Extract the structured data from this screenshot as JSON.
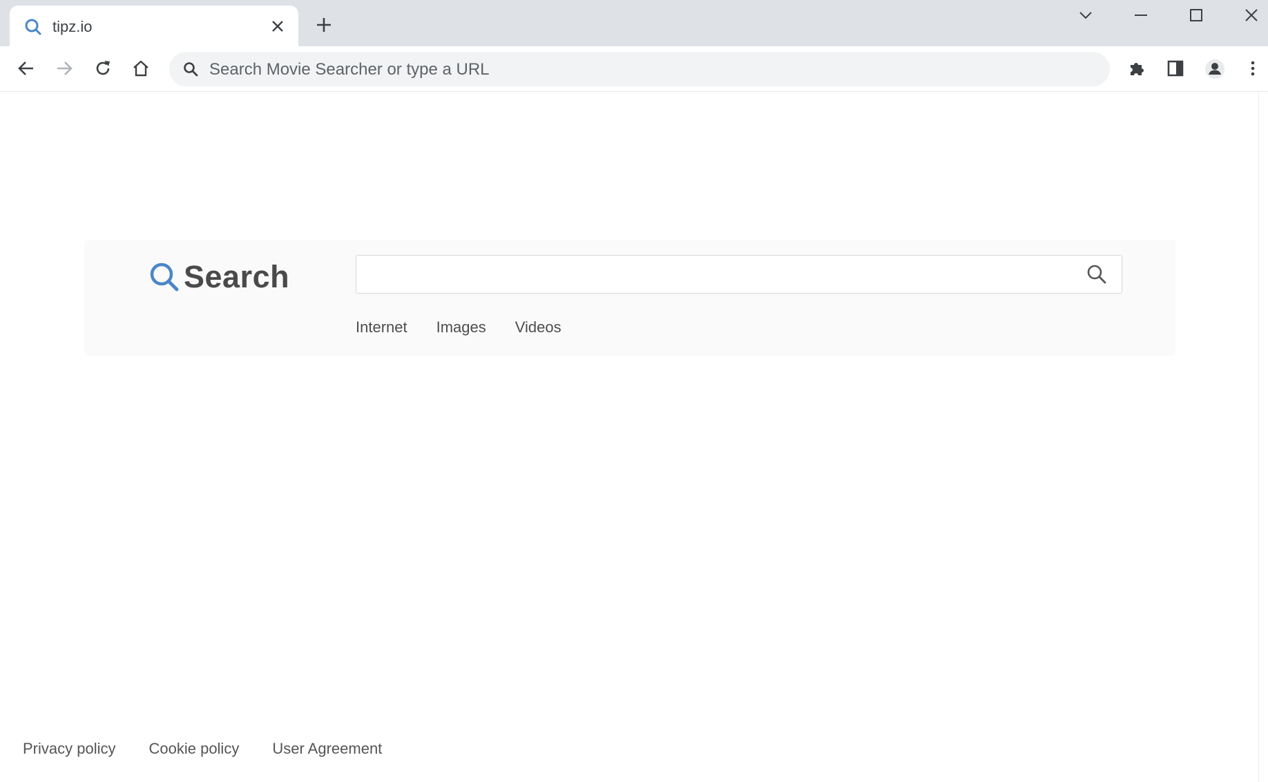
{
  "browser": {
    "tab": {
      "title": "tipz.io"
    },
    "omnibox": {
      "placeholder": "Search Movie Searcher or type a URL"
    }
  },
  "page": {
    "logo": {
      "text": "Search"
    },
    "search": {
      "value": ""
    },
    "search_tabs": [
      "Internet",
      "Images",
      "Videos"
    ],
    "footer_links": [
      "Privacy policy",
      "Cookie policy",
      "User Agreement"
    ]
  },
  "colors": {
    "accent": "#4a86c8",
    "tab_bar": "#dee1e6",
    "omnibox": "#f1f3f4"
  }
}
